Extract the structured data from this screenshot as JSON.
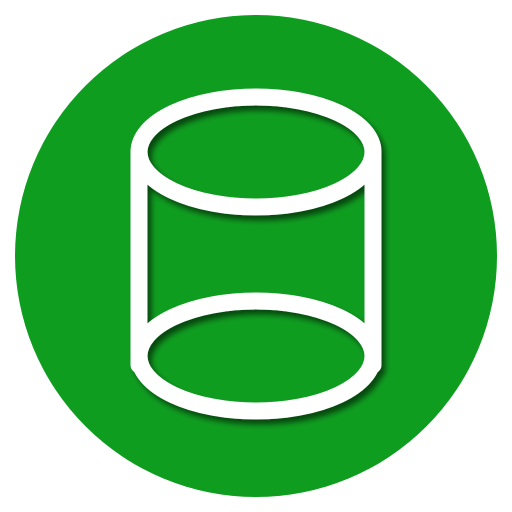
{
  "icon": {
    "name": "cylinder-icon",
    "badge_color": "#0f9d20",
    "stroke_color": "#ffffff",
    "shadow_color": "#07560f"
  }
}
